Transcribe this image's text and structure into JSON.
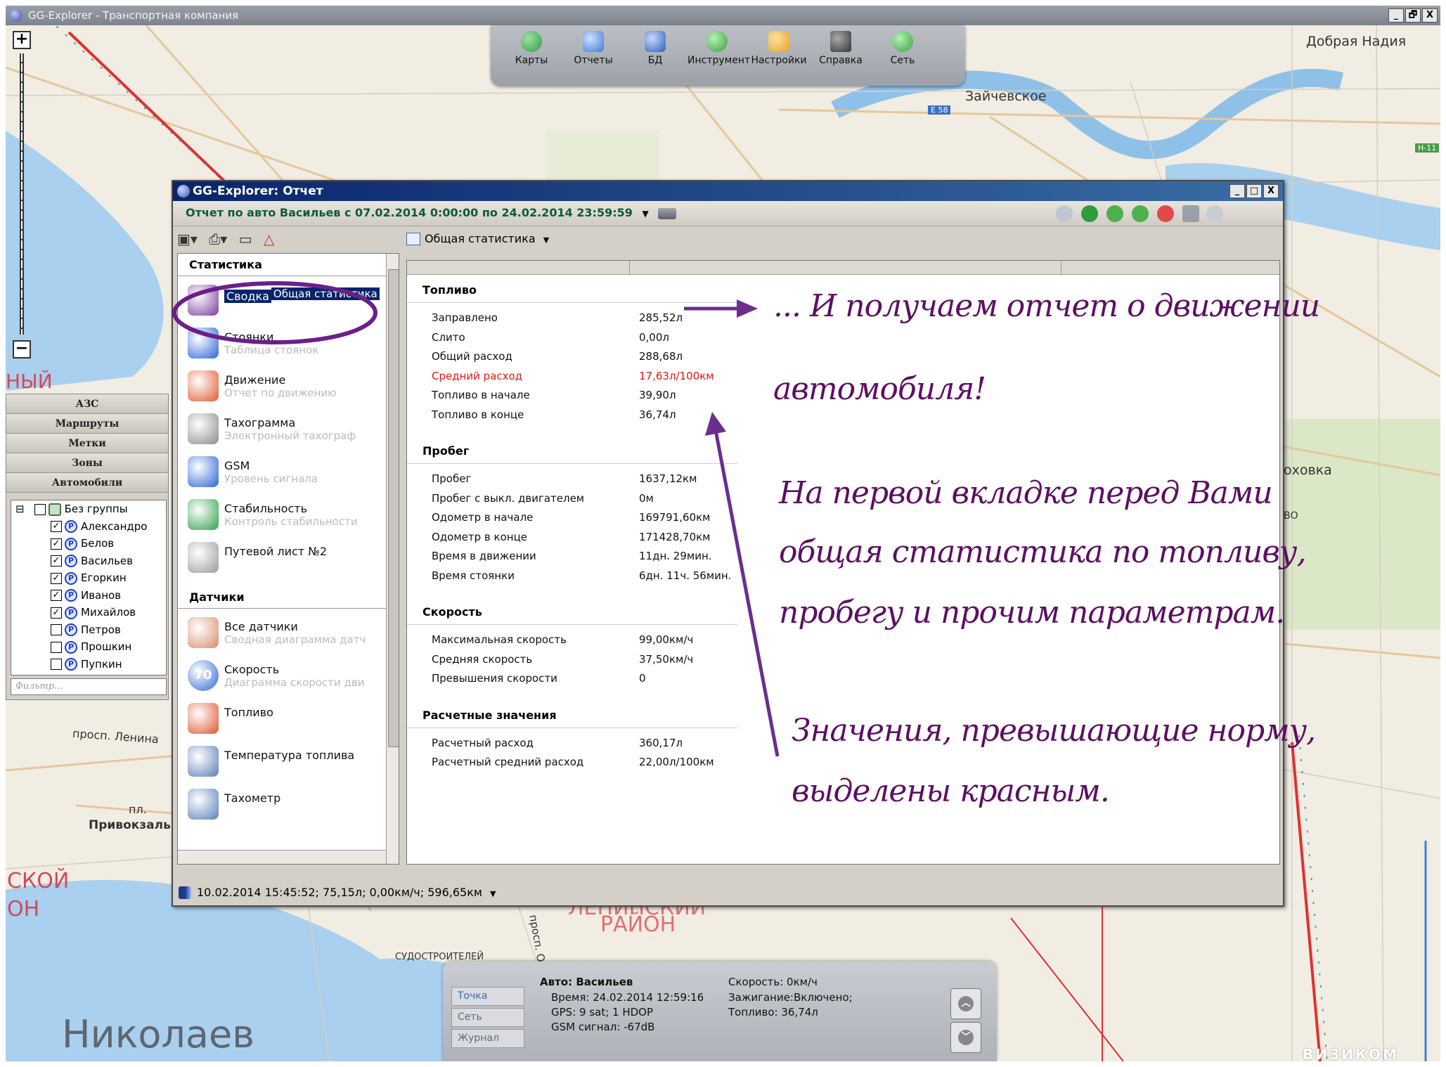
{
  "app": {
    "title": "GG-Explorer - Транспортная компания",
    "window_buttons": [
      "_",
      "🗗",
      "X"
    ]
  },
  "main_toolbar": {
    "items": [
      {
        "label": "Карты",
        "icon": "globe-icon",
        "color": "#2f9c3c"
      },
      {
        "label": "Отчеты",
        "icon": "report-icon",
        "color": "#3d7bd8"
      },
      {
        "label": "БД",
        "icon": "database-icon",
        "color": "#2b5fb8"
      },
      {
        "label": "Инструмент",
        "icon": "tools-globe-icon",
        "color": "#3a9e3a"
      },
      {
        "label": "Настройки",
        "icon": "wrench-icon",
        "color": "#e2a325"
      },
      {
        "label": "Справка",
        "icon": "graduation-cap-icon",
        "color": "#333333"
      },
      {
        "label": "Сеть",
        "icon": "network-globe-icon",
        "color": "#34a23a"
      }
    ]
  },
  "map_labels": {
    "dobraya_nadiya": "Добрая Надия",
    "zaychevskoe": "Зайчевское",
    "e58": "E 58",
    "h11": "H-11",
    "nyy": "НЫЙ",
    "khovka": "оховка",
    "vo": "ВО",
    "prosp_lenina": "просп. Ленина",
    "pl": "пл.",
    "privokzal": "Привокзаль",
    "skoy": "СКОЙ",
    "on": "ОН",
    "leninskiy": "ЛЕНИНСКИЙ",
    "rayon": "РАЙОН",
    "sudostroiteley": "СУДОСТРОИТЕЛЕЙ",
    "prosp_o": "просп. О",
    "nikolaev": "Николаев",
    "watermark": "ВИЗИКОМ"
  },
  "side_panel": {
    "buttons": [
      "АЗС",
      "Маршруты",
      "Метки",
      "Зоны",
      "Автомобили"
    ],
    "tree": [
      {
        "label": "Без группы",
        "checked": false,
        "minus": true
      },
      {
        "label": "Александро",
        "checked": true
      },
      {
        "label": "Белов",
        "checked": true
      },
      {
        "label": "Васильев",
        "checked": true
      },
      {
        "label": "Егоркин",
        "checked": true
      },
      {
        "label": "Иванов",
        "checked": true
      },
      {
        "label": "Михайлов",
        "checked": true
      },
      {
        "label": "Петров",
        "checked": false
      },
      {
        "label": "Прошкин",
        "checked": false
      },
      {
        "label": "Пупкин",
        "checked": false
      }
    ],
    "filter_placeholder": "Фильтр..."
  },
  "report_window": {
    "title": "GG-Explorer: Отчет",
    "subtitle": "Отчет по авто Васильев с 07.02.2014 0:00:00 по 24.02.2014 23:59:59",
    "tab_select": "Общая статистика",
    "status_bar": "10.02.2014 15:45:52; 75,15л; 0,00км/ч; 596,65км"
  },
  "left_panel": {
    "stats_header": "Статистика",
    "stats_items": [
      {
        "title": "Сводка",
        "subtitle": "Общая статистика",
        "selected": true,
        "icon": "summary-chart-icon",
        "color": "#7a3e9d"
      },
      {
        "title": "Стоянки",
        "subtitle": "Таблица стоянок",
        "icon": "parking-icon",
        "color": "#2b64d6"
      },
      {
        "title": "Движение",
        "subtitle": "Отчет по движению",
        "icon": "movement-ring-icon",
        "color": "#e15b2c"
      },
      {
        "title": "Тахограмма",
        "subtitle": "Электронный тахограф",
        "icon": "tachograph-icon",
        "color": "#8b8b8b"
      },
      {
        "title": "GSM",
        "subtitle": "Уровень сигнала",
        "icon": "gsm-signal-icon",
        "color": "#2b64d6"
      },
      {
        "title": "Стабильность",
        "subtitle": "Контроль стабильности",
        "icon": "stability-cubes-icon",
        "color": "#2da14a"
      },
      {
        "title": "Путевой лист №2",
        "subtitle": "",
        "icon": "waybill-icon",
        "color": "#9b9b9b"
      }
    ],
    "sensors_header": "Датчики",
    "sensor_items": [
      {
        "title": "Все датчики",
        "subtitle": "Сводная диаграмма датч",
        "icon": "all-sensors-icon",
        "color": "#d98b6b"
      },
      {
        "title": "Скорость",
        "subtitle": "Диаграмма скорости дви",
        "icon": "speed-sign-icon",
        "color": "#2b64d6",
        "badge": "70"
      },
      {
        "title": "Топливо",
        "subtitle": "",
        "icon": "fuel-icon",
        "color": "#e0552f"
      },
      {
        "title": "Температура топлива",
        "subtitle": "",
        "icon": "fuel-temp-icon",
        "color": "#5b7fb8"
      },
      {
        "title": "Тахометр",
        "subtitle": "",
        "icon": "tachometer-icon",
        "color": "#5b7fb8"
      }
    ]
  },
  "stats": {
    "sections": [
      {
        "title": "Топливо",
        "rows": [
          {
            "label": "Заправлено",
            "value": "285,52л"
          },
          {
            "label": "Слито",
            "value": "0,00л"
          },
          {
            "label": "Общий расход",
            "value": "288,68л"
          },
          {
            "label": "Средний расход",
            "value": "17,63л/100км",
            "highlight": true
          },
          {
            "label": "Топливо в начале",
            "value": "39,90л"
          },
          {
            "label": "Топливо в конце",
            "value": "36,74л"
          }
        ]
      },
      {
        "title": "Пробег",
        "rows": [
          {
            "label": "Пробег",
            "value": "1637,12км"
          },
          {
            "label": "Пробег с выкл. двигателем",
            "value": "0м"
          },
          {
            "label": "Одометр в начале",
            "value": "169791,60км"
          },
          {
            "label": "Одометр в конце",
            "value": "171428,70км"
          },
          {
            "label": "Время в движении",
            "value": "11дн. 29мин."
          },
          {
            "label": "Время стоянки",
            "value": "6дн. 11ч. 56мин."
          }
        ]
      },
      {
        "title": "Скорость",
        "rows": [
          {
            "label": "Максимальная скорость",
            "value": "99,00км/ч"
          },
          {
            "label": "Средняя скорость",
            "value": "37,50км/ч"
          },
          {
            "label": "Превышения скорости",
            "value": "0"
          }
        ]
      },
      {
        "title": "Расчетные значения",
        "rows": [
          {
            "label": "Расчетный расход",
            "value": "360,17л"
          },
          {
            "label": "Расчетный средний расход",
            "value": "22,00л/100км"
          }
        ]
      }
    ]
  },
  "annotations": {
    "line1": "... И получаем отчет о движении",
    "line2": "автомобиля!",
    "line3": "На первой вкладке перед Вами",
    "line4": "общая статистика по топливу,",
    "line5": "пробегу и прочим параметрам.",
    "line6": "Значения, превышающие норму,",
    "line7": "выделены красным.",
    "color": "#5d0f63"
  },
  "info_panel": {
    "tabs": [
      "Точка",
      "Сеть",
      "Журнал"
    ],
    "car_label": "Авто: Васильев",
    "time": "Время: 24.02.2014 12:59:16",
    "gps": "GPS: 9 sat; 1 HDOP",
    "gsm": "GSM сигнал: -67dB",
    "speed": "Скорость: 0км/ч",
    "ignition": "Зажигание:Включено;",
    "fuel": "Топливо: 36,74л"
  }
}
